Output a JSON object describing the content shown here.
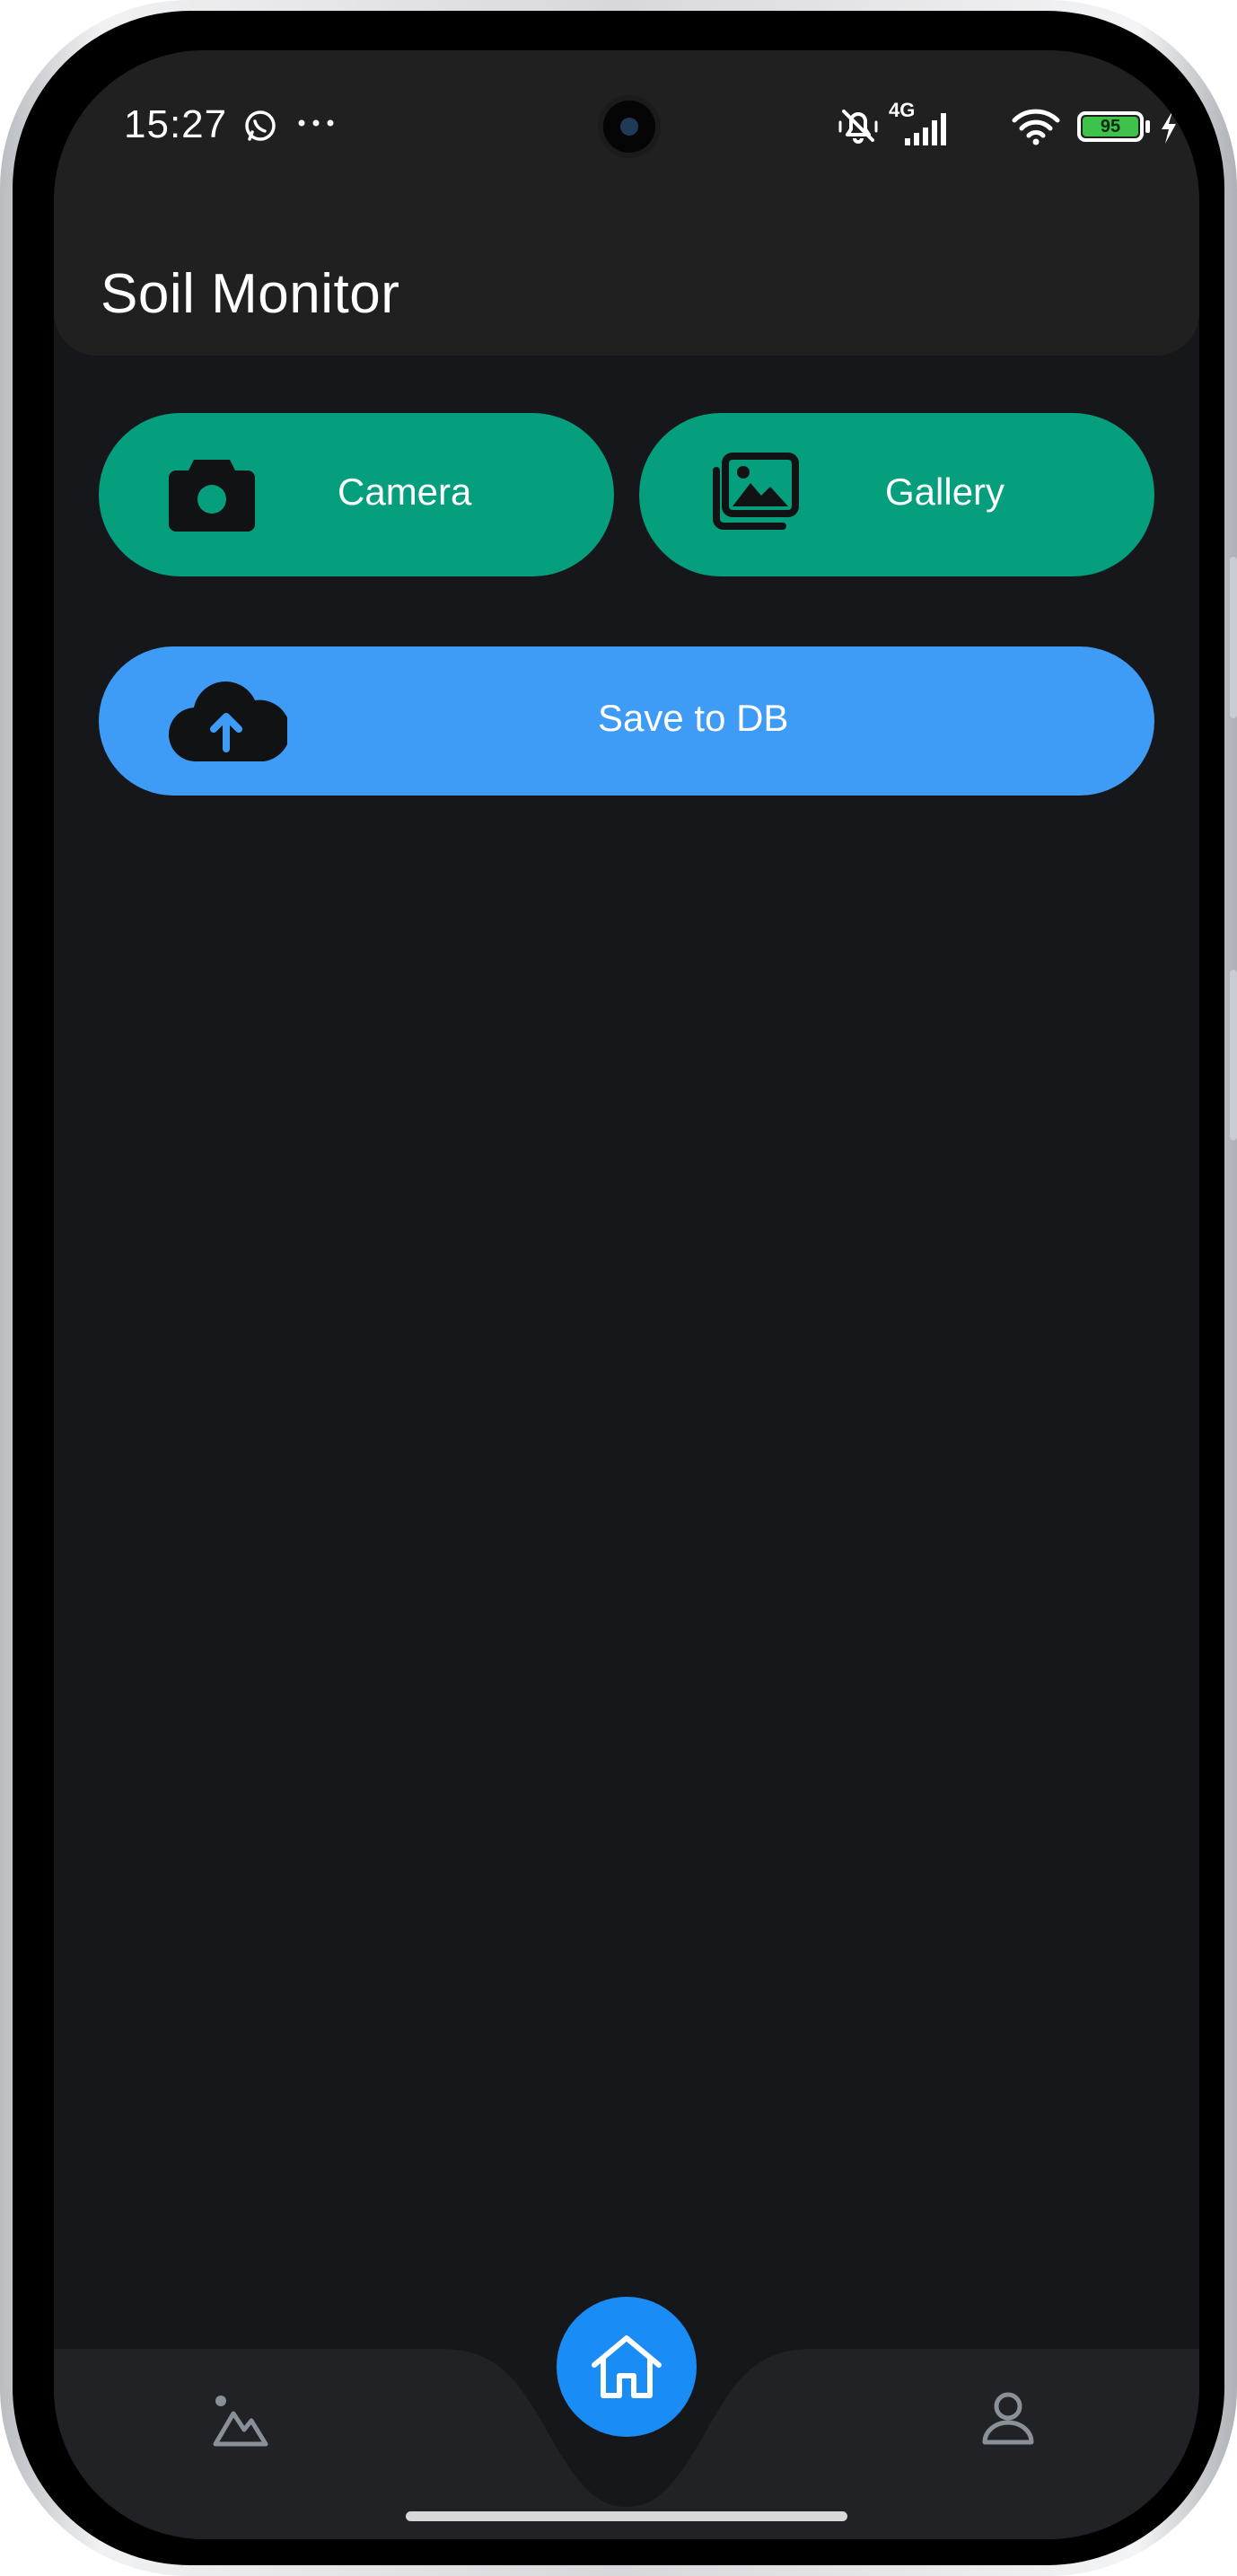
{
  "status_bar": {
    "time": "15:27",
    "network": "4G",
    "battery_level": "95",
    "icons": [
      "whatsapp-icon",
      "more-dots-icon",
      "mute-icon",
      "signal-icon",
      "wifi-icon",
      "battery-icon",
      "charging-icon"
    ]
  },
  "app_bar": {
    "title": "Soil Monitor"
  },
  "actions": {
    "camera_label": "Camera",
    "gallery_label": "Gallery",
    "save_label": "Save to DB"
  },
  "nav": {
    "items": [
      "landscape-icon",
      "home-icon",
      "profile-icon"
    ]
  },
  "colors": {
    "background": "#15171b",
    "app_bar": "#202020",
    "green_button": "#069f7d",
    "blue_button": "#3e9cf7",
    "fab": "#1a8cf5",
    "nav_bar": "#202226"
  }
}
